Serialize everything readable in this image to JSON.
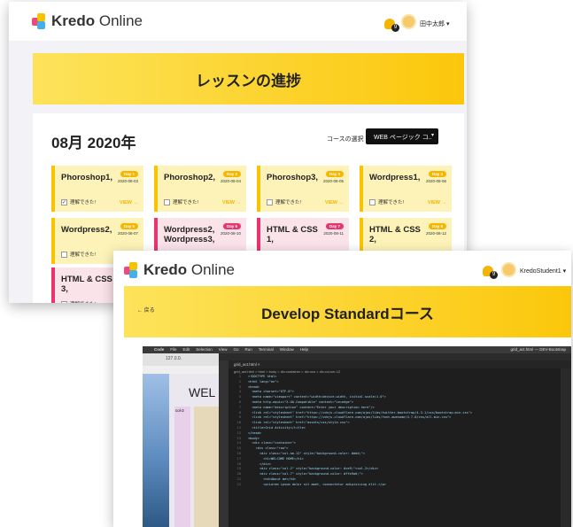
{
  "brand": {
    "name_bold": "Kredo",
    "name_rest": " Online"
  },
  "progress_page": {
    "user": "田中太郎",
    "notif_count": "9",
    "title": "レッスンの進捗",
    "month": "08月 2020年",
    "course_select_label": "コースの選択",
    "course_select_value": "WEB ページック コ..",
    "cards": [
      {
        "title": "Phoroshop1,",
        "badge": "Day 1",
        "date": "2020-08-03",
        "check": "理解できた!",
        "checked": true,
        "view": "VIEW →",
        "tone": "y"
      },
      {
        "title": "Phoroshop2,",
        "badge": "Day 2",
        "date": "2020-08-04",
        "check": "理解できた!",
        "checked": false,
        "view": "VIEW →",
        "tone": "y"
      },
      {
        "title": "Phoroshop3,",
        "badge": "Day 3",
        "date": "2020-08-05",
        "check": "理解できた!",
        "checked": false,
        "view": "VIEW →",
        "tone": "y"
      },
      {
        "title": "Wordpress1,",
        "badge": "Day 4",
        "date": "2020-08-06",
        "check": "理解できた!",
        "checked": false,
        "view": "VIEW →",
        "tone": "y"
      },
      {
        "title": "Wordpress2,",
        "badge": "Day 5",
        "date": "2020-08-07",
        "check": "理解できた!",
        "checked": false,
        "view": "VIEW →",
        "tone": "y"
      },
      {
        "title": "Wordpress2, Wordpress3,",
        "badge": "Day 6",
        "date": "2020-08-10",
        "check": "理解できた!",
        "checked": false,
        "view": "VIEW →",
        "tone": "p"
      },
      {
        "title": "HTML & CSS 1,",
        "badge": "Day 7",
        "date": "2020-08-11",
        "check": "理解できた!",
        "checked": false,
        "view": "VIEW →",
        "tone": "p"
      },
      {
        "title": "HTML & CSS 2,",
        "badge": "Day 8",
        "date": "2020-08-12",
        "check": "理解できた!",
        "checked": false,
        "view": "VIEW →",
        "tone": "y"
      },
      {
        "title": "HTML & CSS 3,",
        "badge": "",
        "date": "",
        "check": "理解できた!",
        "checked": false,
        "view": "",
        "tone": "p"
      }
    ]
  },
  "course_page": {
    "user": "KredoStudent1",
    "notif_count": "9",
    "back": "← 戻る",
    "title": "Develop Standardコース",
    "menu": [
      "Code",
      "File",
      "Edit",
      "Selection",
      "View",
      "Go",
      "Run",
      "Terminal",
      "Window",
      "Help"
    ],
    "window_title": "grid_act.html — DEV-Bootstrap",
    "tab": "grid_act.html",
    "crumb": "grid_act.html > html > body > div.container > div.row > div.col-sm-12",
    "url": "127.0.0.",
    "welcome": "WEL",
    "col_label": "col-2",
    "code": [
      "<!DOCTYPE html>",
      "<html lang=\"en\">",
      "<head>",
      "  <meta charset=\"UTF-8\">",
      "  <meta name=\"viewport\" content=\"width=device-width, initial-scale=1.0\">",
      "  <meta http-equiv=\"X-UA-Compatible\" content=\"ie=edge\">",
      "  <meta name=\"description\" content=\"Enter your description here\"/>",
      "  <link rel=\"stylesheet\" href=\"https://cdnjs.cloudflare.com/ajax/libs/twitter-bootstrap/4.3.1/css/bootstrap.min.css\">",
      "  <link rel=\"stylesheet\" href=\"https://cdnjs.cloudflare.com/ajax/libs/font-awesome/4.7.0/css/all.min.css\">",
      "  <link rel=\"stylesheet\" href=\"assets/css/style.css\">",
      "  <title>Grid Activity</title>",
      "</head>",
      "<body>",
      "  <div class=\"container\">",
      "    <div class=\"row\">",
      "      <div class=\"col-sm-12\" style=\"background-color: #ddd;\">",
      "        <h1>WELCOME HOME</h1>",
      "      </div>",
      "      <div class=\"col-2\" style=\"background-color: #ce9;\">col-2</div>",
      "      <div class=\"col-7\" style=\"background-color: #ffe9a0;\">",
      "        <h4>About me</h4>",
      "        <p>Lorem ipsum dolor sit amet, consectetur adipisicing elit.</p>"
    ]
  }
}
